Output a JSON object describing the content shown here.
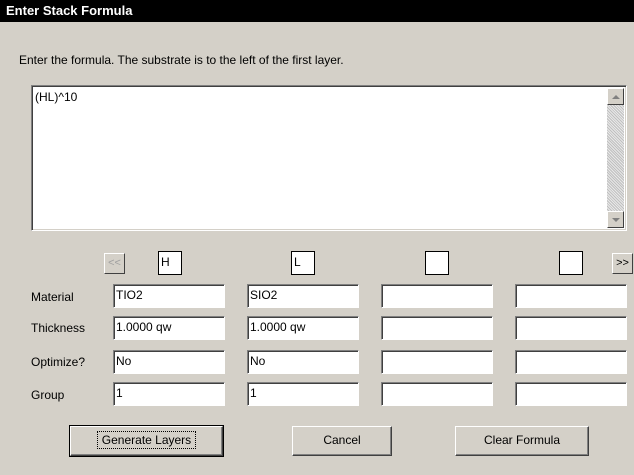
{
  "window": {
    "title": "Enter Stack Formula"
  },
  "prompt": "Enter the formula.  The substrate is to the left of the first layer.",
  "formula": "(HL)^10",
  "nav": {
    "prev": "<<",
    "next": ">>"
  },
  "row_labels": {
    "material": "Material",
    "thickness": "Thickness",
    "optimize": "Optimize?",
    "group": "Group"
  },
  "columns": [
    {
      "symbol": "H",
      "material": "TIO2",
      "thickness": "1.0000 qw",
      "optimize": "No",
      "group": "1"
    },
    {
      "symbol": "L",
      "material": "SIO2",
      "thickness": "1.0000 qw",
      "optimize": "No",
      "group": "1"
    },
    {
      "symbol": "",
      "material": "",
      "thickness": "",
      "optimize": "",
      "group": ""
    },
    {
      "symbol": "",
      "material": "",
      "thickness": "",
      "optimize": "",
      "group": ""
    }
  ],
  "buttons": {
    "generate": "Generate Layers",
    "cancel": "Cancel",
    "clear": "Clear Formula"
  }
}
